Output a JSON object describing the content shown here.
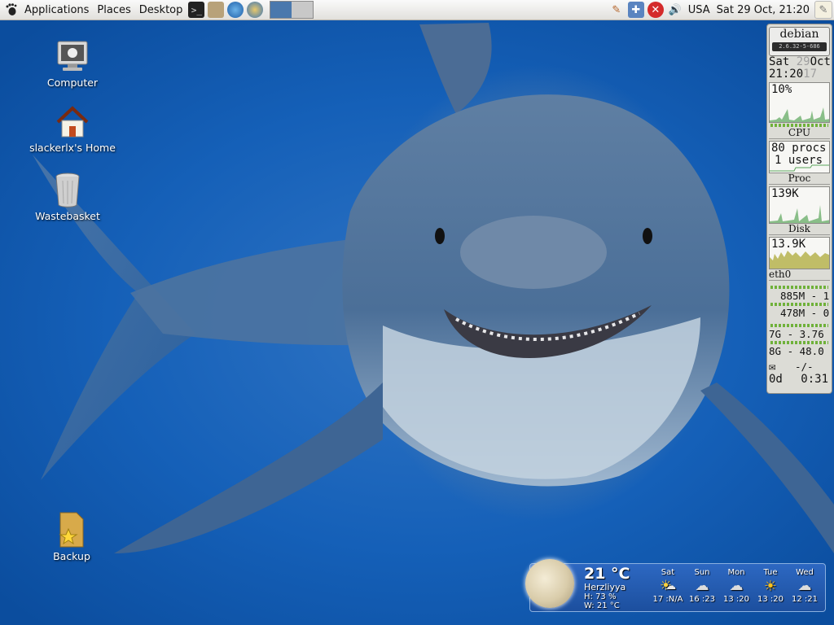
{
  "panel": {
    "menus": [
      "Applications",
      "Places",
      "Desktop"
    ],
    "keyboard_layout": "USA",
    "clock": "Sat 29 Oct, 21:20"
  },
  "desktop_icons": [
    {
      "label": "Computer"
    },
    {
      "label": "slackerlx's Home"
    },
    {
      "label": "Wastebasket"
    },
    {
      "label": "Backup"
    }
  ],
  "gkrellm": {
    "hostname": "debian",
    "kernel": "2.6.32-5-686",
    "clock": {
      "weekday": "Sat",
      "day": "29",
      "month": "Oct",
      "time": "21:20",
      "seconds": "17"
    },
    "cpu": {
      "value": "10%",
      "label": "CPU"
    },
    "proc": {
      "procs": "80 procs",
      "users": "1 users",
      "label": "Proc"
    },
    "disk": {
      "value": "139K",
      "label": "Disk"
    },
    "net": {
      "value": "13.9K",
      "label": "eth0"
    },
    "mem": {
      "row1": "885M - 1.",
      "row2": "478M - 0."
    },
    "fs": {
      "row1": "7G - 3.76",
      "row2": "8G - 48.0"
    },
    "mail": {
      "count": "-/-"
    },
    "uptime": {
      "days": "0d",
      "time": "0:31"
    }
  },
  "weather": {
    "temperature": "21 °C",
    "city": "Herzliyya",
    "humidity": "H: 73 %",
    "wind": "W: 21 °C",
    "forecast": [
      {
        "day": "Sat",
        "temps": "17 :N/A",
        "icon": "sun-cloud-icon"
      },
      {
        "day": "Sun",
        "temps": "16 :23",
        "icon": "rain-cloud-icon"
      },
      {
        "day": "Mon",
        "temps": "13 :20",
        "icon": "rain-cloud-icon"
      },
      {
        "day": "Tue",
        "temps": "13 :20",
        "icon": "sun-icon"
      },
      {
        "day": "Wed",
        "temps": "12 :21",
        "icon": "rain-cloud-icon"
      }
    ]
  }
}
